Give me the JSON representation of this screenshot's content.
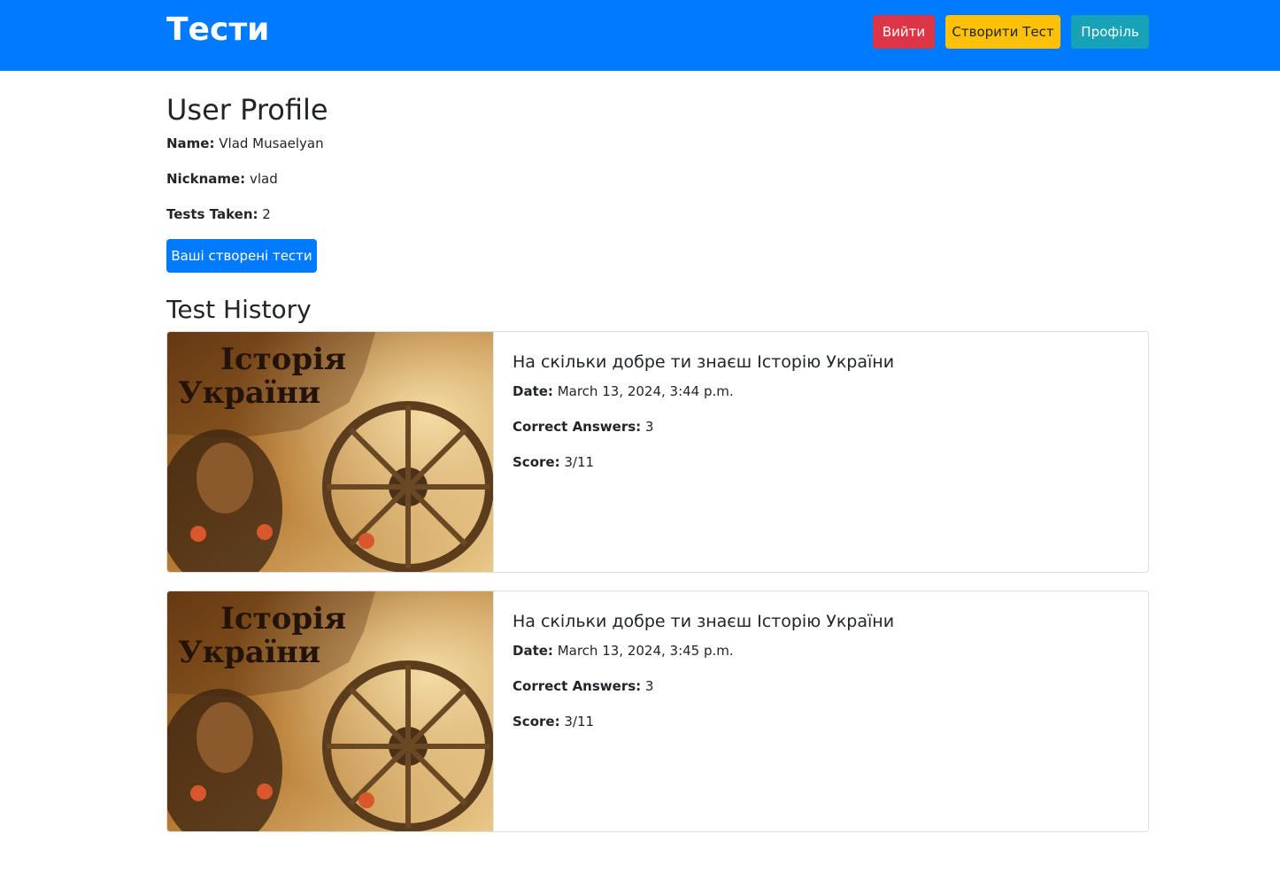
{
  "navbar": {
    "brand": "Тести",
    "logout_label": "Вийти",
    "create_label": "Створити Тест",
    "profile_label": "Профіль",
    "colors": {
      "background": "#007bff",
      "logout": "#dc3545",
      "create": "#ffc107",
      "profile": "#17a2b8"
    }
  },
  "profile": {
    "title": "User Profile",
    "name_label": "Name:",
    "name_value": "Vlad Musaelyan",
    "nickname_label": "Nickname:",
    "nickname_value": "vlad",
    "tests_taken_label": "Tests Taken:",
    "tests_taken_value": "2",
    "my_tests_button": "Ваші створені тести"
  },
  "history": {
    "title": "Test History",
    "image_text_line1": "Історія",
    "image_text_line2": "України",
    "items": [
      {
        "title": "На скільки добре ти знаєш Історію України",
        "date_label": "Date:",
        "date_value": "March 13, 2024, 3:44 p.m.",
        "correct_label": "Correct Answers:",
        "correct_value": "3",
        "score_label": "Score:",
        "score_value": "3/11"
      },
      {
        "title": "На скільки добре ти знаєш Історію України",
        "date_label": "Date:",
        "date_value": "March 13, 2024, 3:45 p.m.",
        "correct_label": "Correct Answers:",
        "correct_value": "3",
        "score_label": "Score:",
        "score_value": "3/11"
      }
    ]
  }
}
